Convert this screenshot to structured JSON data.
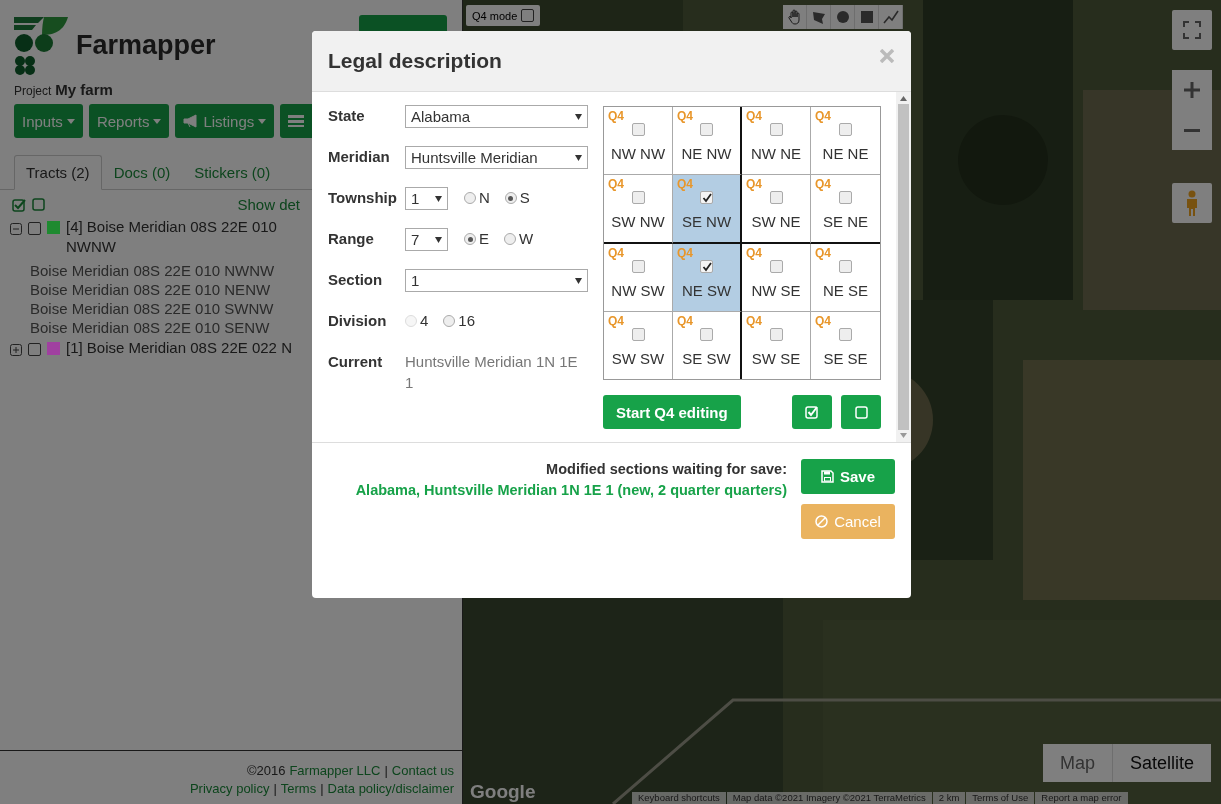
{
  "brand": {
    "name": "Farmapper",
    "project_label": "Project",
    "project_name": "My farm"
  },
  "toolbar": [
    {
      "kind": "dropdown",
      "label": "Inputs"
    },
    {
      "kind": "dropdown",
      "label": "Reports"
    },
    {
      "kind": "announce",
      "label": "Listings"
    },
    {
      "kind": "covered"
    }
  ],
  "tabs": [
    {
      "label": "Tracts (2)",
      "selected": true
    },
    {
      "label": "Docs (0)",
      "selected": false
    },
    {
      "label": "Stickers (0)",
      "selected": false
    }
  ],
  "tract_tools": {
    "show_details": "Show det"
  },
  "tracts": [
    {
      "label": "[4] Boise Meridian 08S 22E 010 NWNW",
      "expanded": true,
      "checked": false,
      "color": "#1e8a30",
      "children": [
        {
          "label": "Boise Meridian 08S 22E 010 NWNW"
        },
        {
          "label": "Boise Meridian 08S 22E 010 NENW"
        },
        {
          "label": "Boise Meridian 08S 22E 010 SWNW"
        },
        {
          "label": "Boise Meridian 08S 22E 010 SENW"
        }
      ]
    },
    {
      "label": "[1] Boise Meridian 08S 22E 022 N",
      "expanded": false,
      "checked": false,
      "color": "#a040a0"
    }
  ],
  "footer": {
    "separator": "|",
    "copyright": "©2016",
    "company_link": "Farmapper LLC",
    "contact_link": "Contact us",
    "links": [
      "Privacy policy",
      "Terms",
      "Data policy/disclaimer"
    ]
  },
  "map": {
    "q4_mode": {
      "label": "Q4 mode",
      "checked": false
    },
    "map_types": [
      {
        "label": "Map",
        "selected": false
      },
      {
        "label": "Satellite",
        "selected": true
      }
    ],
    "logo": "Google",
    "attribution": [
      "Keyboard shortcuts",
      "Map data ©2021 Imagery ©2021 TerraMetrics",
      "2 km",
      "Terms of Use",
      "Report a map error"
    ]
  },
  "dialog": {
    "title": "Legal description",
    "fields": [
      {
        "kind": "select",
        "label": "State",
        "value": "Alabama"
      },
      {
        "kind": "select",
        "label": "Meridian",
        "value": "Huntsville Meridian"
      },
      {
        "kind": "direction",
        "label": "Township",
        "value": "1",
        "options": [
          {
            "label": "N",
            "selected": false,
            "disabled": false
          },
          {
            "label": "S",
            "selected": true,
            "disabled": false
          }
        ]
      },
      {
        "kind": "direction",
        "label": "Range",
        "value": "7",
        "options": [
          {
            "label": "E",
            "selected": true,
            "disabled": false
          },
          {
            "label": "W",
            "selected": false,
            "disabled": false
          }
        ]
      },
      {
        "kind": "select",
        "label": "Section",
        "value": "1"
      },
      {
        "kind": "radio",
        "label": "Division",
        "options": [
          {
            "label": "4",
            "selected": false,
            "disabled": true
          },
          {
            "label": "16",
            "selected": false,
            "disabled": false
          }
        ]
      },
      {
        "kind": "text",
        "label": "Current",
        "value": "Huntsville Meridian 1N 1E 1"
      }
    ],
    "grid": [
      {
        "tag": "Q4",
        "label": "NW NW",
        "checked": false
      },
      {
        "tag": "Q4",
        "label": "NE NW",
        "checked": false
      },
      {
        "tag": "Q4",
        "label": "NW NE",
        "checked": false
      },
      {
        "tag": "Q4",
        "label": "NE NE",
        "checked": false
      },
      {
        "tag": "Q4",
        "label": "SW NW",
        "checked": false
      },
      {
        "tag": "Q4",
        "label": "SE NW",
        "checked": true
      },
      {
        "tag": "Q4",
        "label": "SW NE",
        "checked": false
      },
      {
        "tag": "Q4",
        "label": "SE NE",
        "checked": false
      },
      {
        "tag": "Q4",
        "label": "NW SW",
        "checked": false
      },
      {
        "tag": "Q4",
        "label": "NE SW",
        "checked": true
      },
      {
        "tag": "Q4",
        "label": "NW SE",
        "checked": false
      },
      {
        "tag": "Q4",
        "label": "NE SE",
        "checked": false
      },
      {
        "tag": "Q4",
        "label": "SW SW",
        "checked": false
      },
      {
        "tag": "Q4",
        "label": "SE SW",
        "checked": false
      },
      {
        "tag": "Q4",
        "label": "SW SE",
        "checked": false
      },
      {
        "tag": "Q4",
        "label": "SE SE",
        "checked": false
      }
    ],
    "start_button": "Start Q4 editing",
    "status_heading": "Modified sections waiting for save:",
    "status_detail": "Alabama, Huntsville Meridian 1N 1E 1 (new, 2 quarter quarters)",
    "save": "Save",
    "cancel": "Cancel"
  }
}
